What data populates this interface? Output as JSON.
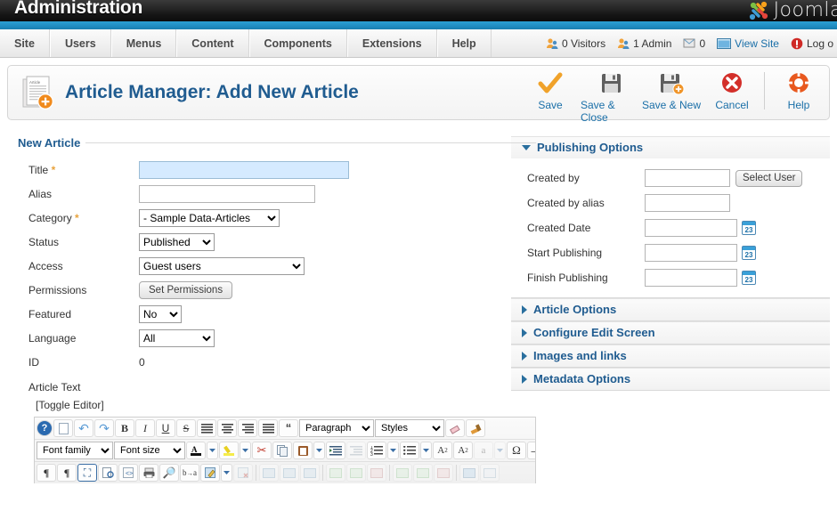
{
  "topbar": {
    "admin_title": "Administration",
    "brand": "Joomla",
    "brand_icon": "joomla-pinwheel-icon"
  },
  "menu": {
    "items": [
      {
        "label": "Site"
      },
      {
        "label": "Users"
      },
      {
        "label": "Menus"
      },
      {
        "label": "Content"
      },
      {
        "label": "Components"
      },
      {
        "label": "Extensions"
      },
      {
        "label": "Help"
      }
    ]
  },
  "status": {
    "visitors": "0 Visitors",
    "admins": "1 Admin",
    "messages": "0",
    "view_site": "View Site",
    "logout": "Log o"
  },
  "page": {
    "title": "Article Manager: Add New Article",
    "icon": "article-add-icon"
  },
  "toolbar": {
    "buttons": [
      {
        "label": "Save",
        "icon": "checkmark-icon"
      },
      {
        "label": "Save & Close",
        "icon": "floppy-disk-icon"
      },
      {
        "label": "Save & New",
        "icon": "floppy-disk-plus-icon"
      },
      {
        "label": "Cancel",
        "icon": "red-x-circle-icon"
      },
      {
        "label": "Help",
        "icon": "lifebuoy-icon"
      }
    ]
  },
  "form": {
    "legend": "New Article",
    "title": {
      "label": "Title",
      "required": "*",
      "value": "",
      "placeholder": ""
    },
    "alias": {
      "label": "Alias",
      "value": "",
      "placeholder": ""
    },
    "category": {
      "label": "Category",
      "required": "*",
      "value": "- Sample Data-Articles"
    },
    "status": {
      "label": "Status",
      "value": "Published"
    },
    "access": {
      "label": "Access",
      "value": "Guest users"
    },
    "permissions": {
      "label": "Permissions",
      "button": "Set Permissions"
    },
    "featured": {
      "label": "Featured",
      "value": "No"
    },
    "language": {
      "label": "Language",
      "value": "All"
    },
    "id": {
      "label": "ID",
      "value": "0"
    },
    "article_text": {
      "label": "Article Text",
      "toggle": "[Toggle Editor]"
    }
  },
  "publishing": {
    "heading": "Publishing Options",
    "fields": [
      {
        "label": "Created by",
        "value": "",
        "button": "Select User"
      },
      {
        "label": "Created by alias",
        "value": ""
      },
      {
        "label": "Created Date",
        "value": "",
        "calendar": "23"
      },
      {
        "label": "Start Publishing",
        "value": "",
        "calendar": "23"
      },
      {
        "label": "Finish Publishing",
        "value": "",
        "calendar": "23"
      }
    ]
  },
  "panels": [
    {
      "label": "Article Options"
    },
    {
      "label": "Configure Edit Screen"
    },
    {
      "label": "Images and links"
    },
    {
      "label": "Metadata Options"
    }
  ],
  "editor": {
    "row1": {
      "buttons": [
        {
          "icon": "help-circle-icon",
          "glyph": "?"
        },
        {
          "icon": "new-document-icon",
          "glyph": "⬜"
        },
        {
          "icon": "undo-icon",
          "glyph": "↶"
        },
        {
          "icon": "redo-icon",
          "glyph": "↷"
        },
        {
          "icon": "bold-icon",
          "glyph": "B"
        },
        {
          "icon": "italic-icon",
          "glyph": "I"
        },
        {
          "icon": "underline-icon",
          "glyph": "U"
        },
        {
          "icon": "strikethrough-icon",
          "glyph": "S"
        },
        {
          "icon": "align-left-icon",
          "glyph": "☰"
        },
        {
          "icon": "align-center-icon",
          "glyph": "☰"
        },
        {
          "icon": "align-right-icon",
          "glyph": "☰"
        },
        {
          "icon": "align-justify-icon",
          "glyph": "☰"
        },
        {
          "icon": "blockquote-icon",
          "glyph": "“"
        }
      ],
      "format_select": "Paragraph",
      "styles_select": "Styles",
      "eraser": {
        "icon": "eraser-icon",
        "glyph": "⌫"
      },
      "brush": {
        "icon": "paintbrush-icon",
        "glyph": "✎"
      }
    },
    "row2": {
      "font_family": "Font family",
      "font_size": "Font size",
      "buttons": [
        {
          "icon": "text-color-icon",
          "glyph": "A"
        },
        {
          "icon": "highlight-color-icon",
          "glyph": "✎"
        },
        {
          "icon": "cut-icon",
          "glyph": "✂"
        },
        {
          "icon": "copy-icon",
          "glyph": "⧉"
        },
        {
          "icon": "paste-icon",
          "glyph": "Ὄb"
        },
        {
          "icon": "indent-icon",
          "glyph": "⇥"
        },
        {
          "icon": "outdent-icon",
          "glyph": "⇤"
        },
        {
          "icon": "numbered-list-icon",
          "glyph": "≡"
        },
        {
          "icon": "bullet-list-icon",
          "glyph": "≡"
        },
        {
          "icon": "subscript-icon",
          "glyph": "A₂"
        },
        {
          "icon": "superscript-icon",
          "glyph": "A²"
        },
        {
          "icon": "remove-format-icon",
          "glyph": "a"
        },
        {
          "icon": "special-character-icon",
          "glyph": "Ω"
        },
        {
          "icon": "horizontal-rule-icon",
          "glyph": "—"
        }
      ]
    },
    "row3": {
      "buttons": [
        {
          "icon": "ltr-icon",
          "glyph": "¶"
        },
        {
          "icon": "rtl-icon",
          "glyph": "¶"
        },
        {
          "icon": "fullscreen-icon",
          "glyph": "⛶"
        },
        {
          "icon": "preview-icon",
          "glyph": "Ὓ9"
        },
        {
          "icon": "html-source-icon",
          "glyph": "◇"
        },
        {
          "icon": "print-icon",
          "glyph": "⎙"
        },
        {
          "icon": "search-icon",
          "glyph": "⌕"
        },
        {
          "icon": "find-replace-icon",
          "glyph": "ba"
        },
        {
          "icon": "edit-image-icon",
          "glyph": "✎"
        },
        {
          "icon": "delete-table-icon",
          "glyph": "⊞"
        },
        {
          "icon": "insert-table-icon",
          "glyph": "⊞"
        },
        {
          "icon": "table-row-props-icon",
          "glyph": "⊞"
        },
        {
          "icon": "table-cell-props-icon",
          "glyph": "⊞"
        },
        {
          "icon": "insert-row-before-icon",
          "glyph": "⊞"
        },
        {
          "icon": "insert-row-after-icon",
          "glyph": "⊞"
        },
        {
          "icon": "delete-row-icon",
          "glyph": "⊞"
        },
        {
          "icon": "insert-column-before-icon",
          "glyph": "⊞"
        },
        {
          "icon": "insert-column-after-icon",
          "glyph": "⊞"
        },
        {
          "icon": "delete-column-icon",
          "glyph": "⊞"
        },
        {
          "icon": "split-cells-icon",
          "glyph": "⊞"
        },
        {
          "icon": "merge-cells-icon",
          "glyph": "□"
        }
      ]
    }
  },
  "colors": {
    "brand_blue": "#1f8cc0",
    "heading_blue": "#205c90",
    "link_blue": "#1a6fa8",
    "accent_orange": "#f08a1c",
    "required_orange": "#e8a33d",
    "focus_field": "#d5eaff"
  }
}
